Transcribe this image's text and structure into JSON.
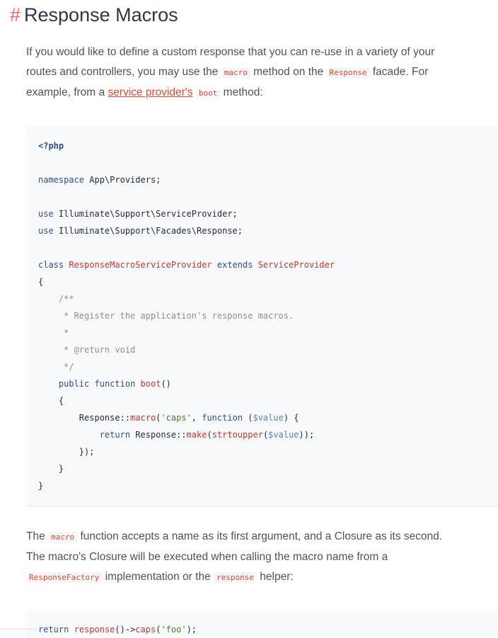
{
  "heading": {
    "hash": "#",
    "title": "Response Macros"
  },
  "intro": {
    "line1": "If you would like to define a custom response that you can re-use in a variety of your",
    "line2_a": "routes and controllers, you may use the ",
    "line2_code1": "macro",
    "line2_b": " method on the ",
    "line2_code2": "Response",
    "line2_c": " facade. For",
    "line3_a": "example, from a ",
    "line3_link": "service provider's",
    "line3_b": " ",
    "line3_code": "boot",
    "line3_c": " method:"
  },
  "code1": {
    "l1": "<?php",
    "l3_kw": "namespace",
    "l3_rest": " App\\Providers;",
    "l5_kw": "use",
    "l5_rest": " Illuminate\\Support\\ServiceProvider;",
    "l6_kw": "use",
    "l6_rest": " Illuminate\\Support\\Facades\\Response;",
    "l8_kw1": "class",
    "l8_cls1": "ResponseMacroServiceProvider",
    "l8_kw2": "extends",
    "l8_cls2": "ServiceProvider",
    "l9": "{",
    "l10": "    /**",
    "l11": "     * Register the application's response macros.",
    "l12": "     *",
    "l13": "     * @return void",
    "l14": "     */",
    "l15_kw1": "public",
    "l15_kw2": "function",
    "l15_fn": "boot",
    "l15_paren": "()",
    "l16": "    {",
    "l17_a": "Response::",
    "l17_fn": "macro",
    "l17_b": "(",
    "l17_str": "'caps'",
    "l17_c": ", ",
    "l17_kw": "function",
    "l17_d": " (",
    "l17_var": "$value",
    "l17_e": ") {",
    "l18_kw": "return",
    "l18_a": " Response::",
    "l18_fn1": "make",
    "l18_b": "(",
    "l18_fn2": "strtoupper",
    "l18_c": "(",
    "l18_var": "$value",
    "l18_d": "));",
    "l19": "        });",
    "l20": "    }",
    "l21": "}"
  },
  "para2": {
    "line1_a": "The ",
    "line1_code": "macro",
    "line1_b": " function accepts a name as its first argument, and a Closure as its second.",
    "line2": "The macro's Closure will be executed when calling the macro name from a",
    "line3_code1": "ResponseFactory",
    "line3_a": " implementation or the ",
    "line3_code2": "response",
    "line3_b": " helper:"
  },
  "code2": {
    "kw": "return",
    "fn1": "response",
    "a": "()->",
    "fn2": "caps",
    "b": "(",
    "str": "'foo'",
    "c": ");"
  },
  "colors": {
    "accent": "#eb4432",
    "hash": "#f4645f",
    "code_bg": "#f8f9fb"
  }
}
